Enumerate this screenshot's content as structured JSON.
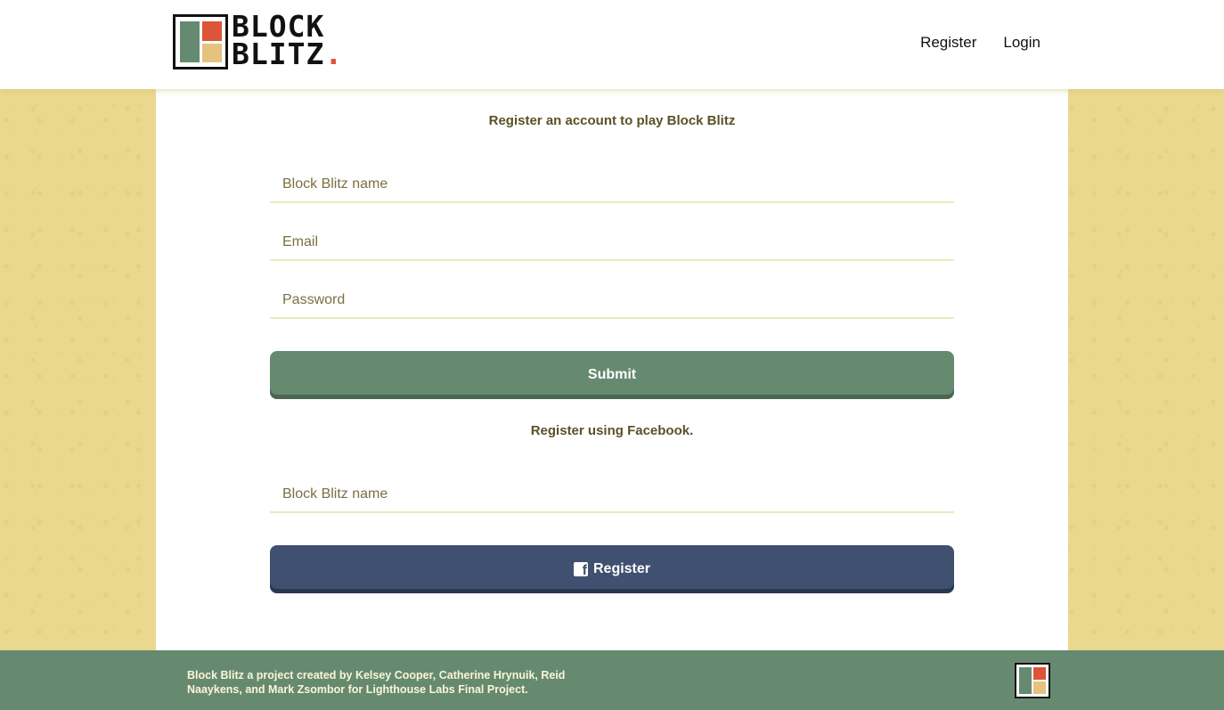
{
  "header": {
    "logo": {
      "line1": "BLOCK",
      "line2": "BLITZ",
      "dot": "."
    },
    "nav": {
      "register": "Register",
      "login": "Login"
    }
  },
  "form": {
    "heading": "Register an account to play Block Blitz",
    "name_placeholder": "Block Blitz name",
    "email_placeholder": "Email",
    "password_placeholder": "Password",
    "submit_label": "Submit"
  },
  "facebook": {
    "heading": "Register using Facebook.",
    "name_placeholder": "Block Blitz name",
    "register_label": "Register",
    "icon": "facebook-icon"
  },
  "footer": {
    "text": "Block Blitz a project created by Kelsey Cooper, Catherine Hrynuik, Reid Naaykens, and Mark Zsombor for Lighthouse Labs Final Project."
  },
  "colors": {
    "green": "#668a70",
    "red": "#dd5538",
    "sand": "#e5c27e",
    "facebook_blue": "#405070",
    "background": "#e9d88e"
  }
}
